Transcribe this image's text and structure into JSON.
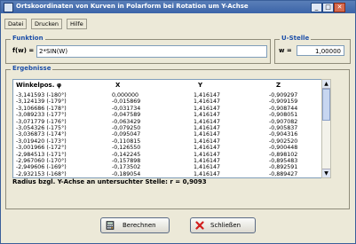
{
  "window": {
    "title": "Ortskoordinaten von Kurven in Polarform bei Rotation um Y-Achse",
    "minimize": "_",
    "maximize": "□",
    "close": "✕"
  },
  "menu": {
    "items": [
      "Datei",
      "Drucken",
      "Hilfe"
    ]
  },
  "funktion": {
    "legend": "Funktion",
    "label": "f(w) =",
    "value": "2*SIN(W)"
  },
  "ustelle": {
    "legend": "U-Stelle",
    "label": "w =",
    "value": "1,00000"
  },
  "ergebnisse": {
    "legend": "Ergebnisse",
    "headers": [
      "Winkelpos. φ",
      "X",
      "Y",
      "Z"
    ],
    "rows": [
      [
        "-3,141593 (-180°)",
        "0,000000",
        "1,416147",
        "-0,909297"
      ],
      [
        "-3,124139 (-179°)",
        "-0,015869",
        "1,416147",
        "-0,909159"
      ],
      [
        "-3,106686 (-178°)",
        "-0,031734",
        "1,416147",
        "-0,908744"
      ],
      [
        "-3,089233 (-177°)",
        "-0,047589",
        "1,416147",
        "-0,908051"
      ],
      [
        "-3,071779 (-176°)",
        "-0,063429",
        "1,416147",
        "-0,907082"
      ],
      [
        "-3,054326 (-175°)",
        "-0,079250",
        "1,416147",
        "-0,905837"
      ],
      [
        "-3,036873 (-174°)",
        "-0,095047",
        "1,416147",
        "-0,904316"
      ],
      [
        "-3,019420 (-173°)",
        "-0,110815",
        "1,416147",
        "-0,902520"
      ],
      [
        "-3,001966 (-172°)",
        "-0,126550",
        "1,416147",
        "-0,900448"
      ],
      [
        "-2,984513 (-171°)",
        "-0,142245",
        "1,416147",
        "-0,898102"
      ],
      [
        "-2,967060 (-170°)",
        "-0,157898",
        "1,416147",
        "-0,895483"
      ],
      [
        "-2,949606 (-169°)",
        "-0,173502",
        "1,416147",
        "-0,892591"
      ],
      [
        "-2,932153 (-168°)",
        "-0,189054",
        "1,416147",
        "-0,889427"
      ]
    ],
    "status": "Radius bzgl. Y-Achse an untersuchter Stelle:  r = 0,9093"
  },
  "buttons": {
    "berechnen": "Berechnen",
    "schliessen": "Schließen"
  }
}
